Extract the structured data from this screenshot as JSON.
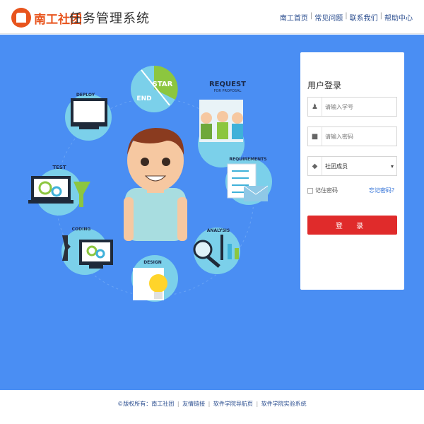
{
  "header": {
    "logo_text": "南工社团",
    "system_title": "任务管理系统",
    "nav": [
      "南工首页",
      "常见问题",
      "联系我们",
      "帮助中心"
    ]
  },
  "illustration": {
    "labels": {
      "star": "STAR",
      "end": "END",
      "request": "REQUEST",
      "request_sub": "FOR PROPOSAL",
      "deploy": "DEPLOY",
      "requirements": "REQUIREMENTS",
      "test": "TEST",
      "coding": "CODING",
      "analysis": "ANALYSIS",
      "design": "DESIGN"
    }
  },
  "login": {
    "title": "用户登录",
    "username_placeholder": "请输入学号",
    "password_placeholder": "请输入密码",
    "role_selected": "社团成员",
    "remember_label": "记住密码",
    "forgot_label": "忘记密码？",
    "submit_label": "登 录"
  },
  "footer": {
    "copyright": "©版权所有：南工社团",
    "links": [
      "友情链接",
      "软件学院导航页",
      "软件学院实验系统"
    ]
  },
  "colors": {
    "main_bg": "#4a8ef3",
    "accent_red": "#e02b2b",
    "logo_orange": "#e8541d"
  }
}
